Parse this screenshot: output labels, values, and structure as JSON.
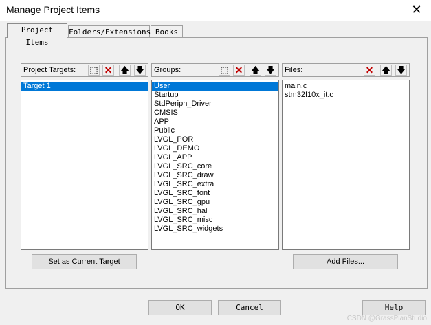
{
  "window": {
    "title": "Manage Project Items",
    "close_glyph": "✕"
  },
  "tabs": [
    {
      "label": "Project Items",
      "active": true
    },
    {
      "label": "Folders/Extensions",
      "active": false
    },
    {
      "label": "Books",
      "active": false
    }
  ],
  "targets_panel": {
    "label": "Project Targets:",
    "items": [
      "Target 1"
    ],
    "selected_index": 0,
    "button_label": "Set as Current Target"
  },
  "groups_panel": {
    "label": "Groups:",
    "items": [
      "User",
      "Startup",
      "StdPeriph_Driver",
      "CMSIS",
      "APP",
      "Public",
      "LVGL_POR",
      "LVGL_DEMO",
      "LVGL_APP",
      "LVGL_SRC_core",
      "LVGL_SRC_draw",
      "LVGL_SRC_extra",
      "LVGL_SRC_font",
      "LVGL_SRC_gpu",
      "LVGL_SRC_hal",
      "LVGL_SRC_misc",
      "LVGL_SRC_widgets"
    ],
    "selected_index": 0
  },
  "files_panel": {
    "label": "Files:",
    "items": [
      "main.c",
      "stm32f10x_it.c"
    ],
    "button_label": "Add Files..."
  },
  "toolbar_icons": {
    "new": "new-icon",
    "delete": "delete-icon",
    "up": "move-up-icon",
    "down": "move-down-icon"
  },
  "colors": {
    "selection": "#0078d7",
    "highlight_box": "#e0342c",
    "delete_icon": "#c00000"
  },
  "footer": {
    "ok_label": "OK",
    "cancel_label": "Cancel",
    "help_label": "Help"
  },
  "watermark": "CSDN @GrassPlanStudio"
}
